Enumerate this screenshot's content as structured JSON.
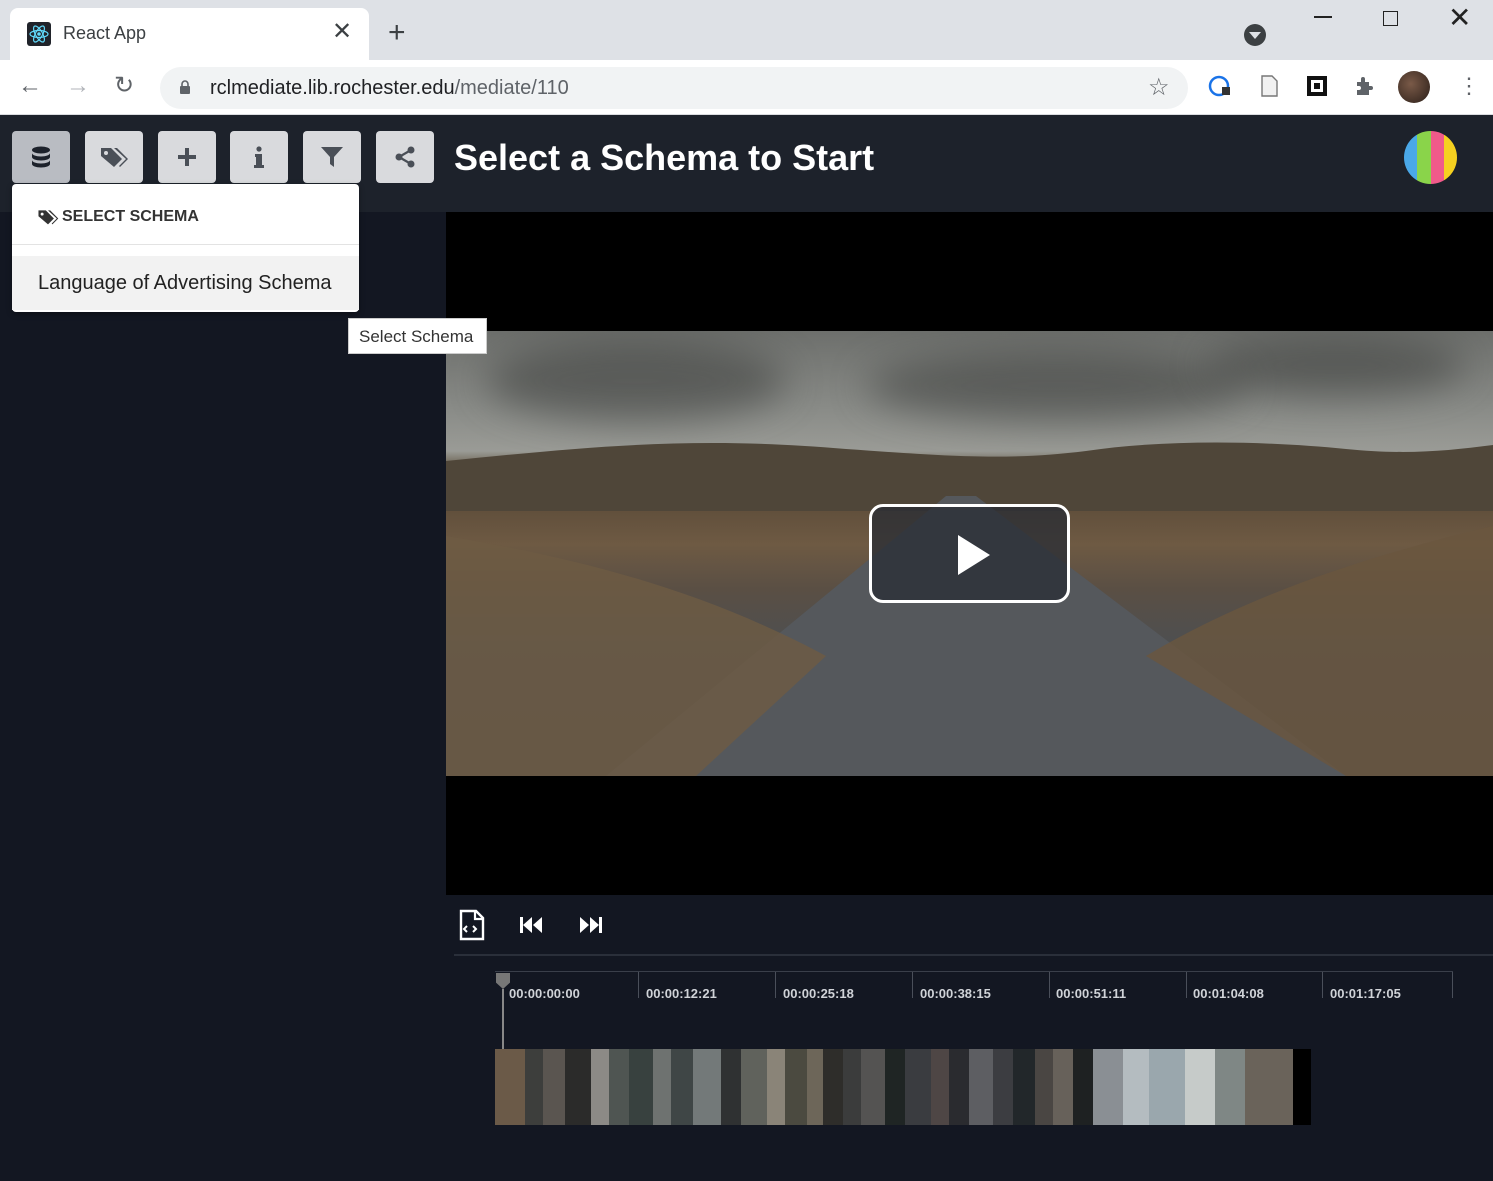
{
  "browser": {
    "tab_title": "React App",
    "url_host": "rclmediate.lib.rochester.edu",
    "url_path": "/mediate/110"
  },
  "header": {
    "buttons": [
      {
        "name": "schema",
        "icon": "database-icon"
      },
      {
        "name": "tags",
        "icon": "tags-icon"
      },
      {
        "name": "add",
        "icon": "plus-icon"
      },
      {
        "name": "info",
        "icon": "info-icon"
      },
      {
        "name": "filter",
        "icon": "filter-icon"
      },
      {
        "name": "share",
        "icon": "share-icon"
      }
    ],
    "title": "Select a Schema to Start",
    "logo_colors": [
      "#4aa8e8",
      "#8ad44a",
      "#f05a8a",
      "#f5d020"
    ]
  },
  "dropdown": {
    "header": "SELECT SCHEMA",
    "items": [
      "Language of Advertising Schema"
    ]
  },
  "tooltip": "Select Schema",
  "player": {
    "play_icon": "play-icon"
  },
  "timeline": {
    "controls": [
      "export-file-icon",
      "skip-back-icon",
      "skip-forward-icon"
    ],
    "ticks": [
      "00:00:00:00",
      "00:00:12:21",
      "00:00:25:18",
      "00:00:38:15",
      "00:00:51:11",
      "00:01:04:08",
      "00:01:17:05"
    ]
  },
  "colors": {
    "header_bg": "#1d222b",
    "panel_bg": "#131722",
    "button_bg": "#d9dadd"
  }
}
